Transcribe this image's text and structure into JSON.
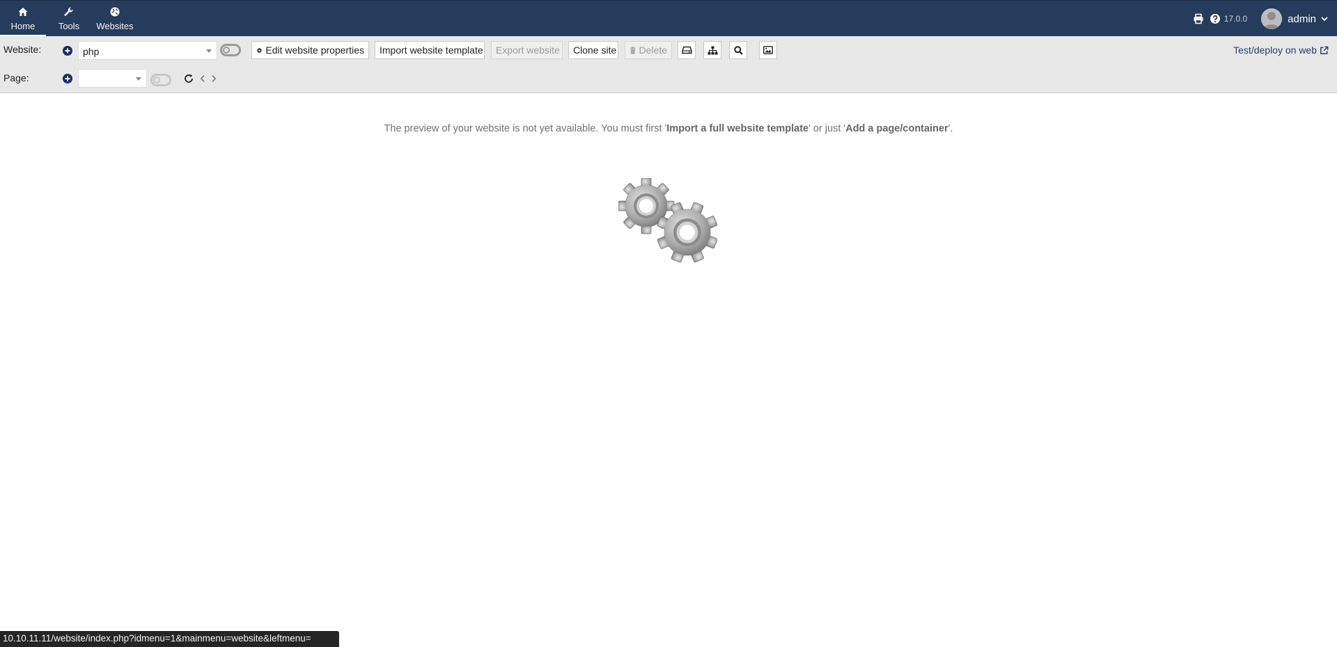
{
  "topnav": {
    "items": [
      {
        "label": "Home",
        "icon": "home-icon"
      },
      {
        "label": "Tools",
        "icon": "wrench-icon"
      },
      {
        "label": "Websites",
        "icon": "globe-icon"
      }
    ],
    "active": "Home",
    "version": "17.0.0",
    "username": "admin"
  },
  "website_toolbar": {
    "label": "Website:",
    "selected_website": "php",
    "buttons": {
      "edit_properties": "Edit website properties",
      "import_template": "Import website template",
      "export": "Export website",
      "clone": "Clone site",
      "delete": "Delete"
    },
    "deploy_link": "Test/deploy on web"
  },
  "page_toolbar": {
    "label": "Page:",
    "selected_page": ""
  },
  "main": {
    "message_start": "The preview of your website is not yet available. You must first '",
    "message_link1": "Import a full website template",
    "message_mid": "' or just '",
    "message_link2": "Add a page/container",
    "message_end": "'."
  },
  "statusbar": {
    "url": "10.10.11.11/website/index.php?idmenu=1&mainmenu=website&leftmenu="
  },
  "colors": {
    "topbar": "#263c5c",
    "toolbar": "#e8e8e8",
    "accent": "#1b2a6d"
  }
}
